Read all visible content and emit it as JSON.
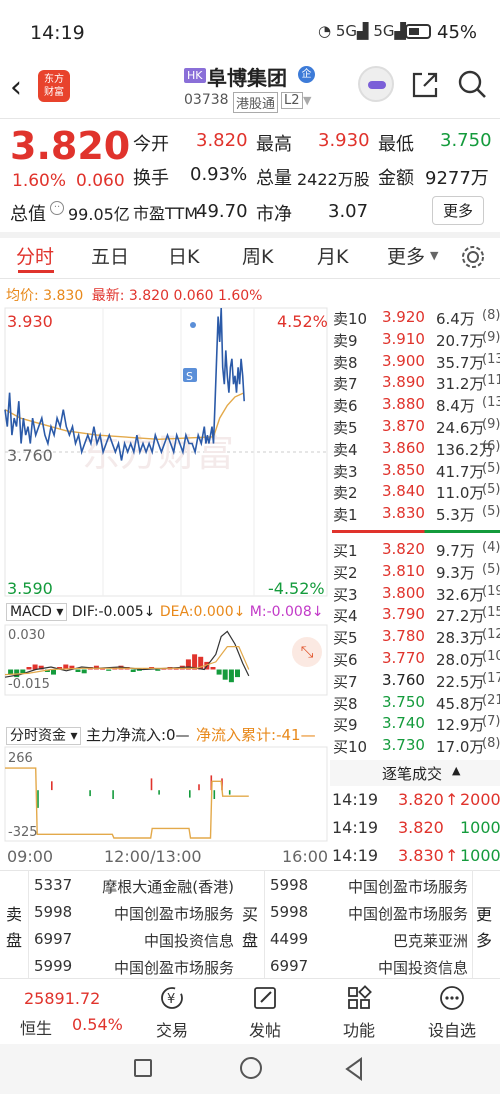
{
  "status_bar": {
    "time": "14:19",
    "battery": "45%"
  },
  "header": {
    "logo_line1": "东方",
    "logo_line2": "财富",
    "hk_tag": "HK",
    "stock_name": "阜博集团",
    "stock_code": "03738",
    "connect_tag": "港股通",
    "level_tag": "L2"
  },
  "quote": {
    "price": "3.820",
    "change_pct": "1.60%",
    "change": "0.060",
    "open_label": "今开",
    "open": "3.820",
    "high_label": "最高",
    "high": "3.930",
    "low_label": "最低",
    "low": "3.750",
    "turnover_label": "换手",
    "turnover": "0.93%",
    "volume_label": "总量",
    "volume": "2422万股",
    "amount_label": "金额",
    "amount": "9277万",
    "mcap_label": "总值",
    "mcap": "99.05亿",
    "pe_label": "市盈TTM",
    "pe": "49.70",
    "pb_label": "市净",
    "pb": "3.07",
    "more_label": "更多"
  },
  "tabs": [
    "分时",
    "五日",
    "日K",
    "周K",
    "月K",
    "更多"
  ],
  "summary": {
    "avg_label": "均价:",
    "avg": "3.830",
    "latest_label": "最新:",
    "latest": "3.820",
    "chg": "0.060",
    "pct": "1.60%"
  },
  "chart_labels": {
    "y_top": "3.930",
    "pct_top": "4.52%",
    "y_mid": "3.760",
    "y_bottom": "3.590",
    "pct_bottom": "-4.52%",
    "s_marker": "S",
    "watermark": "东方财富"
  },
  "macd": {
    "selector": "MACD",
    "dif_label": "DIF:",
    "dif": "-0.005",
    "dea_label": "DEA:",
    "dea": "0.000",
    "m_label": "M:",
    "m": "-0.008",
    "y_top": "0.030",
    "y_bottom": "-0.015"
  },
  "fund": {
    "selector": "分时资金",
    "main_label": "主力净流入:",
    "main_val": "0",
    "cum_label": "净流入累计:",
    "cum_val": "-41",
    "y_top": "266",
    "y_bottom": "-325"
  },
  "time_axis": {
    "start": "09:00",
    "mid": "12:00/13:00",
    "end": "16:00"
  },
  "asks": [
    {
      "label": "卖10",
      "price": "3.920",
      "vol": "6.4万",
      "n": "(8)"
    },
    {
      "label": "卖9",
      "price": "3.910",
      "vol": "20.7万",
      "n": "(9)"
    },
    {
      "label": "卖8",
      "price": "3.900",
      "vol": "35.7万",
      "n": "(13)"
    },
    {
      "label": "卖7",
      "price": "3.890",
      "vol": "31.2万",
      "n": "(11)"
    },
    {
      "label": "卖6",
      "price": "3.880",
      "vol": "8.4万",
      "n": "(13)"
    },
    {
      "label": "卖5",
      "price": "3.870",
      "vol": "24.6万",
      "n": "(9)"
    },
    {
      "label": "卖4",
      "price": "3.860",
      "vol": "136.2万",
      "n": "(6)"
    },
    {
      "label": "卖3",
      "price": "3.850",
      "vol": "41.7万",
      "n": "(5)"
    },
    {
      "label": "卖2",
      "price": "3.840",
      "vol": "11.0万",
      "n": "(5)"
    },
    {
      "label": "卖1",
      "price": "3.830",
      "vol": "5.3万",
      "n": "(5)"
    }
  ],
  "bids": [
    {
      "label": "买1",
      "price": "3.820",
      "vol": "9.7万",
      "n": "(4)"
    },
    {
      "label": "买2",
      "price": "3.810",
      "vol": "9.3万",
      "n": "(5)"
    },
    {
      "label": "买3",
      "price": "3.800",
      "vol": "32.6万",
      "n": "(19)"
    },
    {
      "label": "买4",
      "price": "3.790",
      "vol": "27.2万",
      "n": "(15)"
    },
    {
      "label": "买5",
      "price": "3.780",
      "vol": "28.3万",
      "n": "(12)"
    },
    {
      "label": "买6",
      "price": "3.770",
      "vol": "28.0万",
      "n": "(10)"
    },
    {
      "label": "买7",
      "price": "3.760",
      "vol": "22.5万",
      "n": "(17)"
    },
    {
      "label": "买8",
      "price": "3.750",
      "vol": "45.8万",
      "n": "(21)"
    },
    {
      "label": "买9",
      "price": "3.740",
      "vol": "12.9万",
      "n": "(7)"
    },
    {
      "label": "买10",
      "price": "3.730",
      "vol": "17.0万",
      "n": "(8)"
    }
  ],
  "ticks_title": "逐笔成交",
  "ticks": [
    {
      "time": "14:19",
      "price": "3.820",
      "arrow": "↑",
      "vol": "2000"
    },
    {
      "time": "14:19",
      "price": "3.820",
      "arrow": "",
      "vol": "1000"
    },
    {
      "time": "14:19",
      "price": "3.830",
      "arrow": "↑",
      "vol": "1000"
    }
  ],
  "brokers": {
    "sell_label": "卖盘",
    "buy_label": "买盘",
    "more_label": "更多",
    "sell": [
      {
        "code": "5337",
        "name": "摩根大通金融(香港)"
      },
      {
        "code": "5998",
        "name": "中国创盈市场服务"
      },
      {
        "code": "6997",
        "name": "中国投资信息"
      },
      {
        "code": "5999",
        "name": "中国创盈市场服务"
      }
    ],
    "buy": [
      {
        "code": "5998",
        "name": "中国创盈市场服务"
      },
      {
        "code": "5998",
        "name": "中国创盈市场服务"
      },
      {
        "code": "4499",
        "name": "巴克莱亚洲"
      },
      {
        "code": "6997",
        "name": "中国投资信息"
      }
    ]
  },
  "bottom_bar": {
    "index_value": "25891.72",
    "index_name": "恒生",
    "index_pct": "0.54%",
    "trade": "交易",
    "post": "发帖",
    "features": "功能",
    "watchlist": "设自选"
  },
  "colors": {
    "up": "#e0332c",
    "down": "#149b3c",
    "accent": "#e8891b",
    "line": "#2b5aa8",
    "avg": "#e3a94a"
  }
}
